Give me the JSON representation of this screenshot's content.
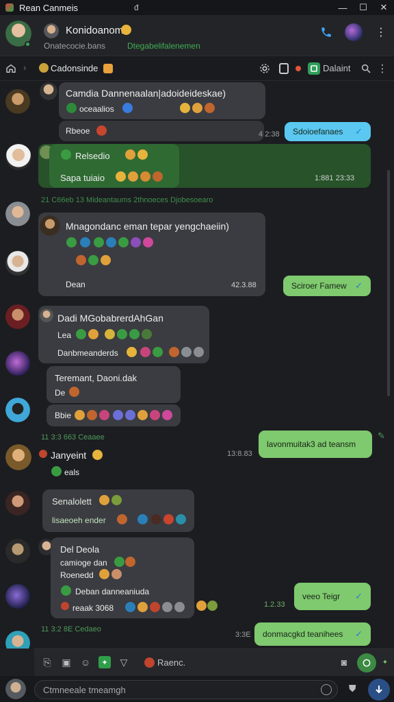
{
  "window": {
    "title": "Rean Canmeis",
    "mid_glyph": "đ",
    "minimize": "—",
    "maximize": "☐",
    "close": "✕"
  },
  "header": {
    "name": "Konidoanom",
    "subtitle_left": "Onatecocie.bans",
    "subtitle_right": "Dtegabelifalenemen"
  },
  "subbar": {
    "channel": "Cadonsinde",
    "action": "Dalaint"
  },
  "messages": {
    "m1_title": "Camdia Dannenaalan|adoideideskae)",
    "m1_line2": "oceaalios",
    "m2_text": "Rbeoe",
    "out1_text": "Sdoioefanaes",
    "out1_time": "4 2:38",
    "m3_line1": "Relsedio",
    "m3_line2": "Sapa tuiaio",
    "m3_time": "1:881 23:33",
    "sys1": "21 C66eb 13  Mideantaums  2thnoeces  Djobesoearo",
    "m4_title": "Mnagondanc eman tepar yengchaeiin)",
    "m4_footer": "Dean",
    "m4_time": "42.3.88",
    "out2_text": "Sciroer Famew",
    "m5_title": "Dadi MGobabrerdAhGan",
    "m5_line2": "Lea",
    "m5_line3": "Danbmeanderds",
    "m6_line1": "Teremant, Daoni.dak",
    "m6_line2": "De",
    "m7_line": "Bbie",
    "sys2": "11 3:3 663   Ceaaee",
    "out3_text": "lavonmuitak3 ad teansm",
    "out3_time": "13:8.83",
    "m8_name": "Janyeint",
    "m8_line": "eals",
    "m9_line1": "Senalolett",
    "m9_line2": "lisaeoeh ender",
    "m10_title": "Del Deola",
    "m10_line2": "camioge dan",
    "m10_line3": "Roenedd",
    "m10_line4": "Deban danneaniuda",
    "m10_line5": "reaak 3068",
    "out4_text": "veeo Teigr",
    "out4_time": "1.2.33",
    "sys3": "11 3:2 8E   Cedaeo",
    "out5_text": "donmacgkd teanihees",
    "out5_time": "3:3E"
  },
  "composer": {
    "chip": "Raenc."
  },
  "input": {
    "placeholder": "Ctmneeale tmeamgh"
  },
  "colors": {
    "accent": "#34a853",
    "bubble_out": "#7fc96e",
    "bubble_blue": "#5ac8f0",
    "check": "#2b7ad8"
  }
}
